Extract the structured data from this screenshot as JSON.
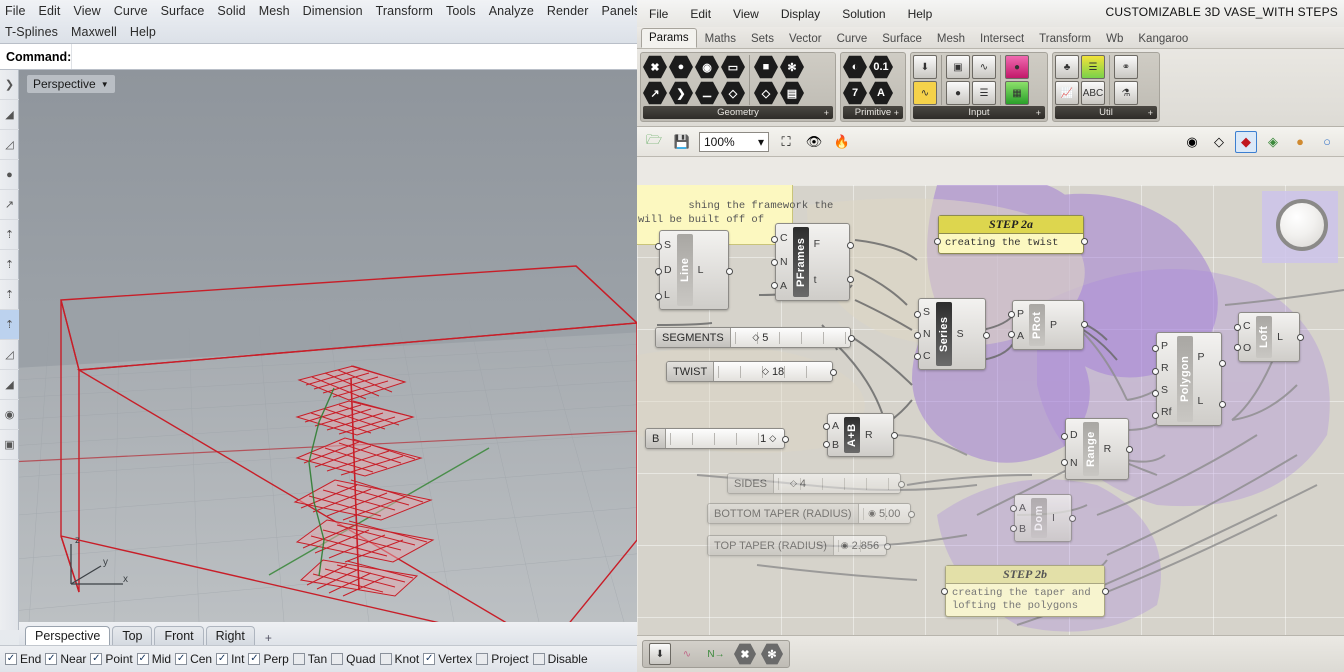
{
  "rhino": {
    "menu_row1": [
      "File",
      "Edit",
      "View",
      "Curve",
      "Surface",
      "Solid",
      "Mesh",
      "Dimension",
      "Transform",
      "Tools",
      "Analyze",
      "Render",
      "Panels"
    ],
    "menu_row2": [
      "T-Splines",
      "Maxwell",
      "Help"
    ],
    "command_label": "Command:",
    "command_value": "",
    "viewport_label": "Perspective",
    "axis": {
      "z": "z",
      "y": "y",
      "x": "x"
    },
    "viewport_tabs": [
      "Perspective",
      "Top",
      "Front",
      "Right"
    ],
    "viewport_tab_active": "Perspective",
    "add_viewport_label": "+",
    "osnaps": [
      {
        "label": "End",
        "checked": true
      },
      {
        "label": "Near",
        "checked": true
      },
      {
        "label": "Point",
        "checked": true
      },
      {
        "label": "Mid",
        "checked": true
      },
      {
        "label": "Cen",
        "checked": true
      },
      {
        "label": "Int",
        "checked": true
      },
      {
        "label": "Perp",
        "checked": true
      },
      {
        "label": "Tan",
        "checked": false
      },
      {
        "label": "Quad",
        "checked": false
      },
      {
        "label": "Knot",
        "checked": false
      },
      {
        "label": "Vertex",
        "checked": true
      },
      {
        "label": "Project",
        "checked": false
      },
      {
        "label": "Disable",
        "checked": false
      }
    ],
    "geometry_color": "#c81e28"
  },
  "grasshopper": {
    "menu": [
      "File",
      "Edit",
      "View",
      "Display",
      "Solution",
      "Help"
    ],
    "document_title": "CUSTOMIZABLE 3D VASE_WITH STEPS",
    "tabs": [
      "Params",
      "Maths",
      "Sets",
      "Vector",
      "Curve",
      "Surface",
      "Mesh",
      "Intersect",
      "Transform",
      "Wb",
      "Kangaroo"
    ],
    "tab_active": "Params",
    "ribbon_groups": [
      {
        "label": "Geometry",
        "expander": "+"
      },
      {
        "label": "Primitive",
        "expander": "+"
      },
      {
        "label": "Input",
        "expander": "+"
      },
      {
        "label": "Util",
        "expander": "+"
      }
    ],
    "canvas_toolbar": {
      "zoom_value": "100%",
      "zoom_caret": "▾"
    },
    "notes": [
      {
        "id": "framework",
        "text": "shing the framework the\nwill be built off of"
      },
      {
        "id": "step2a",
        "title": "STEP 2a",
        "body": "creating the twist"
      },
      {
        "id": "step2b",
        "title": "STEP 2b",
        "body": "creating the taper and\nlofting the polygons"
      }
    ],
    "nodes": [
      {
        "id": "line",
        "caption": "Line",
        "inputs": [
          "S",
          "D",
          "L"
        ],
        "outputs": [
          "L"
        ]
      },
      {
        "id": "pframes",
        "caption": "PFrames",
        "inputs": [
          "C",
          "N",
          "A"
        ],
        "outputs": [
          "F",
          "t"
        ]
      },
      {
        "id": "series",
        "caption": "Series",
        "inputs": [
          "S",
          "N",
          "C"
        ],
        "outputs": [
          "S"
        ]
      },
      {
        "id": "prot",
        "caption": "PRot",
        "inputs": [
          "P",
          "A"
        ],
        "outputs": [
          "P"
        ]
      },
      {
        "id": "aplusb",
        "caption": "A+B",
        "inputs": [
          "A",
          "B"
        ],
        "outputs": [
          "R"
        ]
      },
      {
        "id": "polygon",
        "caption": "Polygon",
        "inputs": [
          "P",
          "R",
          "S",
          "Rf"
        ],
        "outputs": [
          "P",
          "L"
        ]
      },
      {
        "id": "loft",
        "caption": "Loft",
        "inputs": [
          "C",
          "O"
        ],
        "outputs": [
          "L"
        ]
      },
      {
        "id": "range",
        "caption": "Range",
        "inputs": [
          "D",
          "N"
        ],
        "outputs": [
          "R"
        ]
      },
      {
        "id": "dom",
        "caption": "Dom",
        "inputs": [
          "A",
          "B"
        ],
        "outputs": [
          "I"
        ]
      }
    ],
    "sliders": [
      {
        "id": "segments",
        "name": "SEGMENTS",
        "value": "5",
        "knob": 0.22,
        "faded": false
      },
      {
        "id": "twist",
        "name": "TWIST",
        "value": "18",
        "knob": 0.5,
        "faded": false
      },
      {
        "id": "b",
        "name": "B",
        "value": "1",
        "knob": 0.92,
        "faded": false
      },
      {
        "id": "sides",
        "name": "SIDES",
        "value": "4",
        "knob": 0.1,
        "faded": true
      },
      {
        "id": "bottom",
        "name": "BOTTOM TAPER (RADIUS)",
        "value": "5.00",
        "knob": 0.5,
        "faded": true
      },
      {
        "id": "top",
        "name": "TOP TAPER (RADIUS)",
        "value": "2.856",
        "knob": 0.3,
        "faded": true
      }
    ]
  }
}
